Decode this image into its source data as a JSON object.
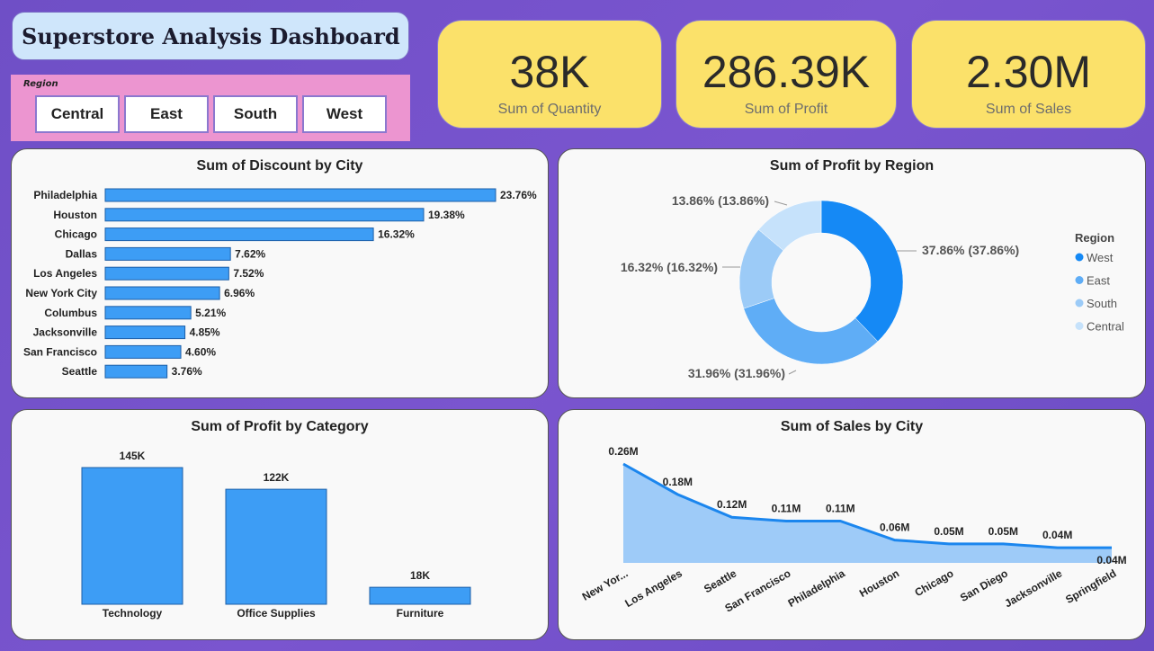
{
  "header": {
    "title": "Superstore Analysis Dashboard"
  },
  "slicer": {
    "label": "Region",
    "options": [
      "Central",
      "East",
      "South",
      "West"
    ]
  },
  "kpis": [
    {
      "value": "38K",
      "label": "Sum of Quantity"
    },
    {
      "value": "286.39K",
      "label": "Sum of Profit"
    },
    {
      "value": "2.30M",
      "label": "Sum of Sales"
    }
  ],
  "colors": {
    "bar": "#3d9df5",
    "accent_west": "#1589f5",
    "accent_east": "#5fadf6",
    "accent_south": "#9ccbf7",
    "accent_central": "#c6e2fb",
    "area": "#9ecbf8",
    "line": "#1b86ee"
  },
  "chart_data": [
    {
      "type": "bar",
      "orientation": "horizontal",
      "title": "Sum of Discount by City",
      "categories": [
        "Philadelphia",
        "Houston",
        "Chicago",
        "Dallas",
        "Los Angeles",
        "New York City",
        "Columbus",
        "Jacksonville",
        "San Francisco",
        "Seattle"
      ],
      "values": [
        23.76,
        19.38,
        16.32,
        7.62,
        7.52,
        6.96,
        5.21,
        4.85,
        4.6,
        3.76
      ],
      "data_labels": [
        "23.76%",
        "19.38%",
        "16.32%",
        "7.62%",
        "7.52%",
        "6.96%",
        "5.21%",
        "4.85%",
        "4.60%",
        "3.76%"
      ],
      "xlim": [
        0,
        23.76
      ]
    },
    {
      "type": "pie",
      "donut": true,
      "title": "Sum of Profit by Region",
      "legend_title": "Region",
      "legend_position": "right",
      "categories": [
        "West",
        "East",
        "South",
        "Central"
      ],
      "values": [
        37.86,
        31.96,
        16.32,
        13.86
      ],
      "data_labels": [
        "37.86% (37.86%)",
        "31.96% (31.96%)",
        "16.32% (16.32%)",
        "13.86% (13.86%)"
      ]
    },
    {
      "type": "bar",
      "title": "Sum of Profit by Category",
      "categories": [
        "Technology",
        "Office Supplies",
        "Furniture"
      ],
      "values": [
        145,
        122,
        18
      ],
      "data_labels": [
        "145K",
        "122K",
        "18K"
      ],
      "ylim": [
        0,
        145
      ]
    },
    {
      "type": "area",
      "title": "Sum of Sales by City",
      "categories": [
        "New Yor...",
        "Los Angeles",
        "Seattle",
        "San Francisco",
        "Philadelphia",
        "Houston",
        "Chicago",
        "San Diego",
        "Jacksonville",
        "Springfield"
      ],
      "values": [
        0.26,
        0.18,
        0.12,
        0.11,
        0.11,
        0.06,
        0.05,
        0.05,
        0.04,
        0.04
      ],
      "data_labels": [
        "0.26M",
        "0.18M",
        "0.12M",
        "0.11M",
        "0.11M",
        "0.06M",
        "0.05M",
        "0.05M",
        "0.04M",
        "0.04M"
      ],
      "ylim": [
        0,
        0.26
      ]
    }
  ]
}
